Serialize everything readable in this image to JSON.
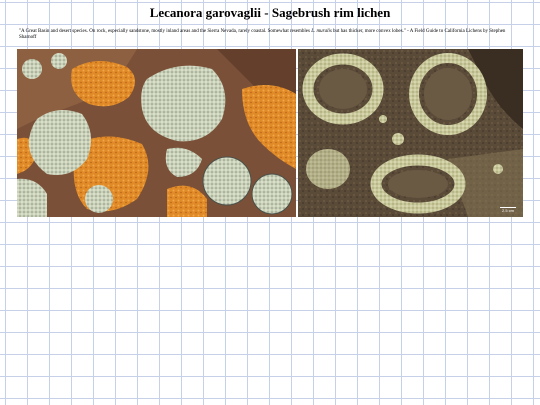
{
  "page": {
    "title": "Lecanora garovaglii - Sagebrush rim lichen"
  },
  "description": {
    "text_before": "\"A Great Basin and desert species. On rock, especially sandstone, mostly inland areas and the Sierra Nevada, rarely coastal. Somewhat resembles ",
    "species_italic": "L. muralis",
    "text_after": " but has thicker, more convex lobes.\" - A Field Guide to California Lichens by Stephen Sharnoff"
  },
  "photos": {
    "left": {
      "subject": "Pale grey-green rosette lichens with orange crustose lichen on reddish-brown rock",
      "colors": {
        "rock": "#7a5038",
        "orange": "#e08a28",
        "lichen": "#c8d0b0"
      }
    },
    "right": {
      "subject": "Pale yellow-green lichen rosettes on dark brown rock",
      "colors": {
        "rock": "#5a4a38",
        "lichen": "#c8c89a"
      },
      "scale_label": "2.5 cm"
    }
  }
}
